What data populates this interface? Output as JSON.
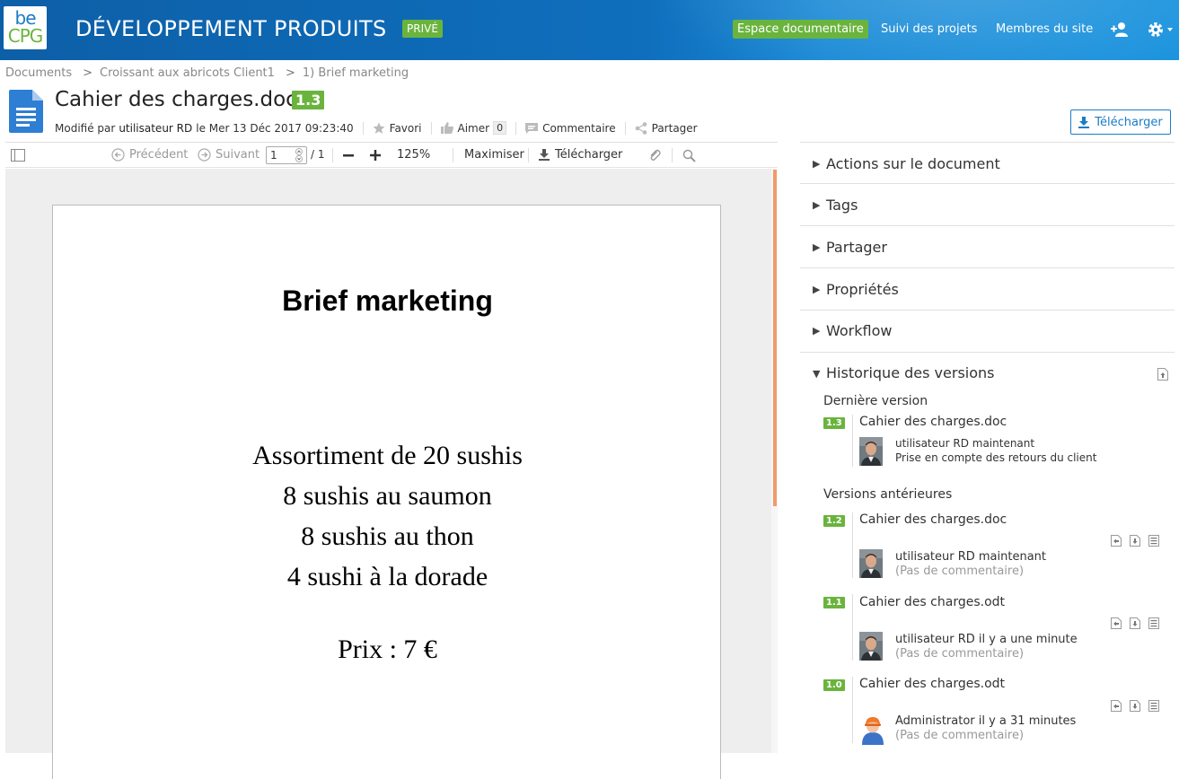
{
  "header": {
    "logo_top": "be",
    "logo_bottom": "CPG",
    "site_title": "DÉVELOPPEMENT PRODUITS",
    "visibility_badge": "PRIVÉ",
    "nav": {
      "espace": "Espace documentaire",
      "suivi": "Suivi des projets",
      "membres": "Membres du site"
    },
    "icons": [
      "add-user-icon",
      "gear-icon"
    ],
    "colors": {
      "header_bg": "#0f6fbd",
      "accent_green": "#6ab43e"
    }
  },
  "breadcrumb": [
    "Documents",
    "Croissant aux abricots Client1",
    "1) Brief marketing"
  ],
  "breadcrumb_sep": ">",
  "document": {
    "title": "Cahier des charges.doc",
    "version": "1.3",
    "modified_prefix": "Modifié par",
    "modified_user": "utilisateur RD",
    "modified_suffix": "le Mer 13 Déc 2017 09:23:40",
    "actions": {
      "favori": "Favori",
      "aimer": "Aimer",
      "aimer_count": "0",
      "commentaire": "Commentaire",
      "partager": "Partager"
    },
    "download_button": "Télécharger"
  },
  "viewer": {
    "toolbar": {
      "previous": "Précédent",
      "next": "Suivant",
      "page_value": "1",
      "page_total": "/ 1",
      "zoom": "125%",
      "maximize": "Maximiser",
      "download": "Télécharger"
    },
    "page": {
      "heading": "Brief marketing",
      "lines": [
        "Assortiment de 20 sushis",
        "8 sushis au saumon",
        "8 sushis au thon",
        "4 sushi à la dorade"
      ],
      "price": "Prix : 7 €"
    }
  },
  "panel": {
    "sections": [
      "Actions sur le document",
      "Tags",
      "Partager",
      "Propriétés",
      "Workflow",
      "Historique des versions"
    ],
    "history": {
      "latest_heading": "Dernière version",
      "previous_heading": "Versions antérieures",
      "latest": {
        "version": "1.3",
        "name": "Cahier des charges.doc",
        "user_time": "utilisateur RD maintenant",
        "comment": "Prise en compte des retours du client"
      },
      "previous": [
        {
          "version": "1.2",
          "name": "Cahier des charges.doc",
          "user_time": "utilisateur RD maintenant",
          "comment": "(Pas de commentaire)"
        },
        {
          "version": "1.1",
          "name": "Cahier des charges.odt",
          "user_time": "utilisateur RD il y a une minute",
          "comment": "(Pas de commentaire)"
        },
        {
          "version": "1.0",
          "name": "Cahier des charges.odt",
          "user_time": "Administrator il y a 31 minutes",
          "comment": "(Pas de commentaire)"
        }
      ]
    }
  }
}
